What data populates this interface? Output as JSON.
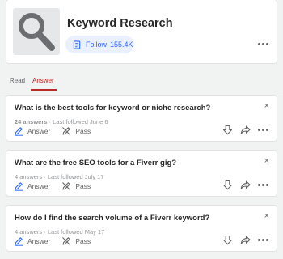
{
  "topic": {
    "title": "Keyword Research",
    "follow_label": "Follow",
    "follow_count": "155.4K"
  },
  "tabs": [
    {
      "label": "Read",
      "active": false
    },
    {
      "label": "Answer",
      "active": true
    }
  ],
  "questions": [
    {
      "title": "What is the best tools for keyword or niche research?",
      "answers": "24 answers",
      "sep": "·",
      "followed": "Last followed June 6",
      "answer_label": "Answer",
      "pass_label": "Pass"
    },
    {
      "title": "What are the free SEO tools for a Fiverr gig?",
      "answers": "4 answers",
      "sep": "·",
      "followed": "Last followed July 17",
      "answer_label": "Answer",
      "pass_label": "Pass"
    },
    {
      "title": "How do I find the search volume of a Fiverr keyword?",
      "answers": "4 answers",
      "sep": "·",
      "followed": "Last followed May 17",
      "answer_label": "Answer",
      "pass_label": "Pass"
    }
  ],
  "icons": {
    "topic": "magnifier-icon",
    "close": "×",
    "answer": "pencil-icon",
    "pass": "pass-icon",
    "downvote": "downvote-icon",
    "share": "share-icon",
    "more": "more-icon"
  },
  "colors": {
    "accent": "#2e69ff",
    "active_tab": "#b92b27",
    "background": "#f1f2f2"
  }
}
